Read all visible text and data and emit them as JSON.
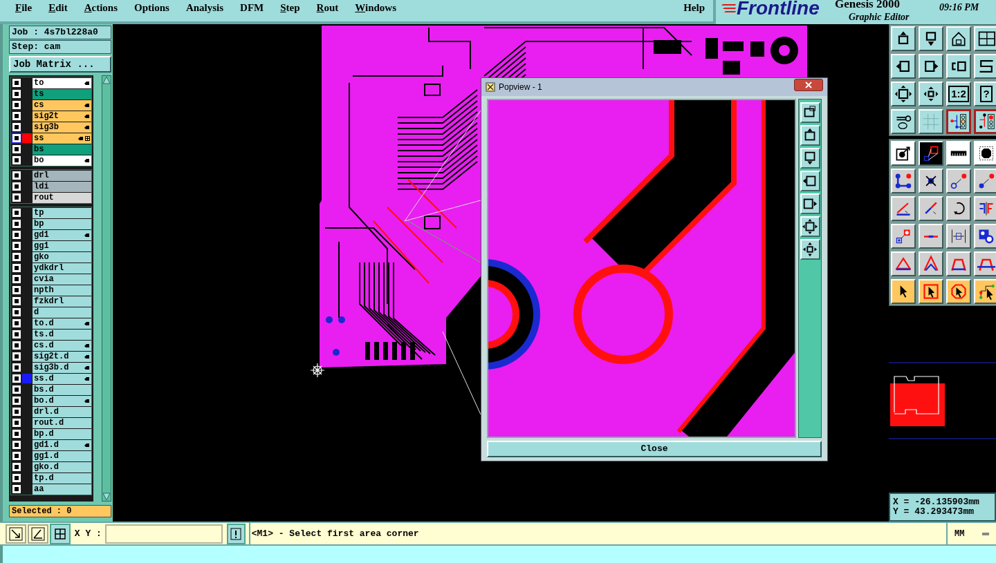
{
  "menu": [
    {
      "label": "File",
      "mnemonic": true
    },
    {
      "label": "Edit",
      "mnemonic": true
    },
    {
      "label": "Actions",
      "mnemonic": true
    },
    {
      "label": "Options",
      "mnemonic": false
    },
    {
      "label": "Analysis",
      "mnemonic": false
    },
    {
      "label": "DFM",
      "mnemonic": false
    },
    {
      "label": "Step",
      "mnemonic": true
    },
    {
      "label": "Rout",
      "mnemonic": true
    },
    {
      "label": "Windows",
      "mnemonic": true
    }
  ],
  "help": "Help",
  "brand": {
    "logo": "Frontline",
    "product": "Genesis 2000",
    "subtitle": "Graphic Editor",
    "time": "09:16 PM"
  },
  "job": "Job : 4s7bl228a0",
  "step": "Step: cam",
  "job_matrix_button": "Job Matrix ...",
  "layer_groups": [
    [
      {
        "name": "to",
        "kind": "silk",
        "hand": true,
        "checked": false,
        "focused": false,
        "grid_mark": false
      },
      {
        "name": "ts",
        "kind": "mask",
        "hand": false,
        "checked": false,
        "focused": false,
        "grid_mark": false
      },
      {
        "name": "cs",
        "kind": "signal",
        "hand": true,
        "checked": false,
        "focused": false,
        "grid_mark": false
      },
      {
        "name": "sig2t",
        "kind": "signal",
        "hand": true,
        "checked": false,
        "focused": false,
        "grid_mark": false
      },
      {
        "name": "sig3b",
        "kind": "signal",
        "hand": true,
        "checked": false,
        "focused": false,
        "grid_mark": false
      },
      {
        "name": "ss",
        "kind": "signal",
        "hand": true,
        "checked": false,
        "focused": true,
        "grid_mark": true,
        "color": "#ff0000"
      },
      {
        "name": "bs",
        "kind": "mask",
        "hand": false,
        "checked": false,
        "focused": false,
        "grid_mark": false
      },
      {
        "name": "bo",
        "kind": "silk",
        "hand": true,
        "checked": false,
        "focused": false,
        "grid_mark": false
      }
    ],
    [
      {
        "name": "drl",
        "kind": "drill",
        "hand": false,
        "checked": false,
        "focused": false,
        "grid_mark": false
      },
      {
        "name": "ldi",
        "kind": "drill",
        "hand": false,
        "checked": false,
        "focused": false,
        "grid_mark": false
      },
      {
        "name": "rout",
        "kind": "rout",
        "hand": false,
        "checked": false,
        "focused": false,
        "grid_mark": false
      }
    ],
    [
      {
        "name": "tp",
        "kind": "misc",
        "hand": false,
        "checked": false,
        "focused": false,
        "grid_mark": false
      },
      {
        "name": "bp",
        "kind": "misc",
        "hand": false,
        "checked": false,
        "focused": false,
        "grid_mark": false
      },
      {
        "name": "gd1",
        "kind": "misc",
        "hand": true,
        "checked": false,
        "focused": false,
        "grid_mark": false
      },
      {
        "name": "gg1",
        "kind": "misc",
        "hand": false,
        "checked": false,
        "focused": false,
        "grid_mark": false
      },
      {
        "name": "gko",
        "kind": "misc",
        "hand": false,
        "checked": false,
        "focused": false,
        "grid_mark": false
      },
      {
        "name": "ydkdrl",
        "kind": "misc",
        "hand": false,
        "checked": false,
        "focused": false,
        "grid_mark": false
      },
      {
        "name": "cvia",
        "kind": "misc",
        "hand": false,
        "checked": false,
        "focused": false,
        "grid_mark": false
      },
      {
        "name": "npth",
        "kind": "misc",
        "hand": false,
        "checked": false,
        "focused": false,
        "grid_mark": false
      },
      {
        "name": "fzkdrl",
        "kind": "misc",
        "hand": false,
        "checked": false,
        "focused": false,
        "grid_mark": false
      },
      {
        "name": "d",
        "kind": "misc",
        "hand": false,
        "checked": false,
        "focused": false,
        "grid_mark": false
      },
      {
        "name": "to.d",
        "kind": "misc",
        "hand": true,
        "checked": false,
        "focused": false,
        "grid_mark": false
      },
      {
        "name": "ts.d",
        "kind": "misc",
        "hand": false,
        "checked": false,
        "focused": false,
        "grid_mark": false
      },
      {
        "name": "cs.d",
        "kind": "misc",
        "hand": true,
        "checked": false,
        "focused": false,
        "grid_mark": false
      },
      {
        "name": "sig2t.d",
        "kind": "misc",
        "hand": true,
        "checked": false,
        "focused": false,
        "grid_mark": false
      },
      {
        "name": "sig3b.d",
        "kind": "misc",
        "hand": true,
        "checked": false,
        "focused": false,
        "grid_mark": false
      },
      {
        "name": "ss.d",
        "kind": "misc",
        "hand": true,
        "checked": false,
        "focused": false,
        "grid_mark": false,
        "color": "#1a1aff"
      },
      {
        "name": "bs.d",
        "kind": "misc",
        "hand": false,
        "checked": false,
        "focused": false,
        "grid_mark": false
      },
      {
        "name": "bo.d",
        "kind": "misc",
        "hand": true,
        "checked": false,
        "focused": false,
        "grid_mark": false
      },
      {
        "name": "drl.d",
        "kind": "misc",
        "hand": false,
        "checked": false,
        "focused": false,
        "grid_mark": false
      },
      {
        "name": "rout.d",
        "kind": "misc",
        "hand": false,
        "checked": false,
        "focused": false,
        "grid_mark": false
      },
      {
        "name": "bp.d",
        "kind": "misc",
        "hand": false,
        "checked": false,
        "focused": false,
        "grid_mark": false
      },
      {
        "name": "gd1.d",
        "kind": "misc",
        "hand": true,
        "checked": false,
        "focused": false,
        "grid_mark": false
      },
      {
        "name": "gg1.d",
        "kind": "misc",
        "hand": false,
        "checked": false,
        "focused": false,
        "grid_mark": false
      },
      {
        "name": "gko.d",
        "kind": "misc",
        "hand": false,
        "checked": false,
        "focused": false,
        "grid_mark": false
      },
      {
        "name": "tp.d",
        "kind": "misc",
        "hand": false,
        "checked": false,
        "focused": false,
        "grid_mark": false
      },
      {
        "name": "aa",
        "kind": "misc",
        "hand": false,
        "checked": false,
        "focused": false,
        "grid_mark": false
      }
    ]
  ],
  "selected_count": "Selected : 0",
  "popview": {
    "title": "Popview - 1",
    "close_button": "Close"
  },
  "tools": [
    {
      "kind": "teal",
      "selected": false
    },
    {
      "kind": "teal",
      "selected": false
    },
    {
      "kind": "teal",
      "selected": false
    },
    {
      "kind": "teal",
      "selected": false
    },
    {
      "kind": "teal",
      "selected": false
    },
    {
      "kind": "teal",
      "selected": false
    },
    {
      "kind": "teal",
      "selected": false
    },
    {
      "kind": "teal",
      "selected": false
    },
    {
      "kind": "teal",
      "selected": false
    },
    {
      "kind": "teal",
      "selected": false
    },
    {
      "kind": "teal",
      "selected": false,
      "label": "1:2"
    },
    {
      "kind": "teal",
      "selected": false,
      "label": "?"
    },
    {
      "kind": "teal",
      "selected": false
    },
    {
      "kind": "teal",
      "selected": false
    },
    {
      "kind": "teal",
      "selected": true
    },
    {
      "kind": "teal",
      "selected": true
    },
    {
      "kind": "white",
      "selected": false
    },
    {
      "kind": "black",
      "selected": false
    },
    {
      "kind": "white",
      "selected": false
    },
    {
      "kind": "white",
      "selected": false
    },
    {
      "kind": "gray",
      "selected": false
    },
    {
      "kind": "gray",
      "selected": false
    },
    {
      "kind": "gray",
      "selected": false
    },
    {
      "kind": "gray",
      "selected": false
    },
    {
      "kind": "gray",
      "selected": false
    },
    {
      "kind": "gray",
      "selected": false
    },
    {
      "kind": "gray",
      "selected": false
    },
    {
      "kind": "gray",
      "selected": false
    },
    {
      "kind": "gray",
      "selected": false
    },
    {
      "kind": "gray",
      "selected": false
    },
    {
      "kind": "gray",
      "selected": false
    },
    {
      "kind": "gray",
      "selected": false
    },
    {
      "kind": "gray",
      "selected": false
    },
    {
      "kind": "gray",
      "selected": false
    },
    {
      "kind": "gray",
      "selected": false
    },
    {
      "kind": "gray",
      "selected": false
    },
    {
      "kind": "orange",
      "selected": false
    },
    {
      "kind": "orange",
      "selected": false
    },
    {
      "kind": "orange",
      "selected": false
    },
    {
      "kind": "orange",
      "selected": false
    }
  ],
  "coordinates": {
    "x": "X = -26.135903mm",
    "y": "Y = 43.293473mm"
  },
  "bottom": {
    "xy_label": "X Y :",
    "message": "<M1> - Select first area corner",
    "units": "MM"
  }
}
